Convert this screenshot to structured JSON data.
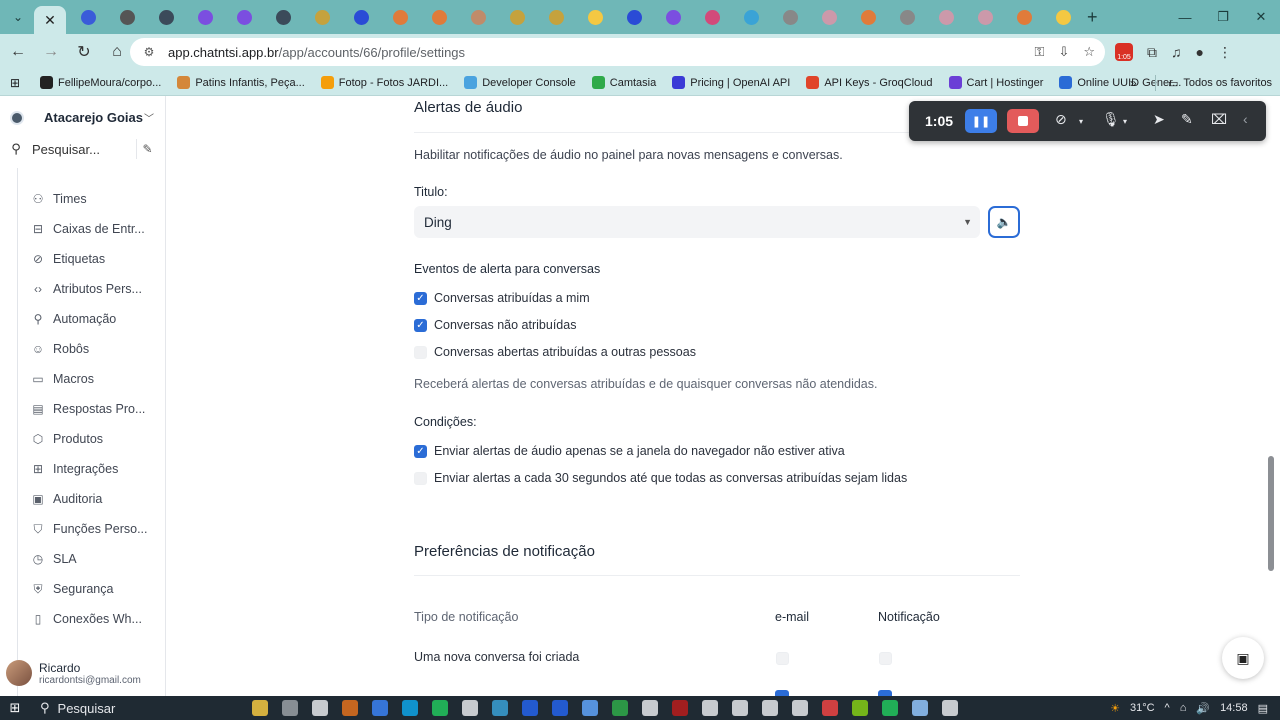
{
  "browser": {
    "tab_icons": [
      "#3a5bd9",
      "#555",
      "#3b4a5a",
      "#7b4ee0",
      "#7b4ee0",
      "#3b4a5a",
      "#c5a23d",
      "#2a4bd6",
      "#e07b3a",
      "#e07b3a",
      "#c08b6a",
      "#c5a23d",
      "#c5a23d",
      "#f4c842",
      "#2a4bd6",
      "#7b4ee0",
      "#d24a7a",
      "#3aa3d6",
      "#888",
      "#c9a",
      "#e07b3a",
      "#888",
      "#c9a",
      "#c9a",
      "#e07b3a",
      "#f4c842"
    ],
    "url_host": "app.chatntsi.app.br",
    "url_path": "/app/accounts/66/profile/settings",
    "bookmarks": [
      {
        "label": "FellipeMoura/corpo...",
        "color": "#222"
      },
      {
        "label": "Patins Infantis, Peça...",
        "color": "#d4873a"
      },
      {
        "label": "Fotop - Fotos JARDI...",
        "color": "#f59e0b"
      },
      {
        "label": "Developer Console",
        "color": "#4aa3df"
      },
      {
        "label": "Camtasia",
        "color": "#2faa4a"
      },
      {
        "label": "Pricing | OpenAI API",
        "color": "#3a3ad6"
      },
      {
        "label": "API Keys - GroqCloud",
        "color": "#e0452a"
      },
      {
        "label": "Cart | Hostinger",
        "color": "#6b3fd6"
      },
      {
        "label": "Online UUID Gener...",
        "color": "#2a6bd6"
      }
    ],
    "all_bookmarks": "Todos os favoritos",
    "rec_badge": "1:05"
  },
  "sidebar": {
    "account_name": "Atacarejo Goias",
    "search_placeholder": "Pesquisar...",
    "items": [
      {
        "label": "Times",
        "icon": "users-icon",
        "glyph": "⚇"
      },
      {
        "label": "Caixas de Entr...",
        "icon": "inbox-icon",
        "glyph": "⊟"
      },
      {
        "label": "Etiquetas",
        "icon": "tag-icon",
        "glyph": "⊘"
      },
      {
        "label": "Atributos Pers...",
        "icon": "code-icon",
        "glyph": "‹›"
      },
      {
        "label": "Automação",
        "icon": "automation-icon",
        "glyph": "⚲"
      },
      {
        "label": "Robôs",
        "icon": "bot-icon",
        "glyph": "☺"
      },
      {
        "label": "Macros",
        "icon": "macro-icon",
        "glyph": "▭"
      },
      {
        "label": "Respostas Pro...",
        "icon": "reply-icon",
        "glyph": "▤"
      },
      {
        "label": "Produtos",
        "icon": "box-icon",
        "glyph": "⬡"
      },
      {
        "label": "Integrações",
        "icon": "integration-icon",
        "glyph": "⊞"
      },
      {
        "label": "Auditoria",
        "icon": "briefcase-icon",
        "glyph": "▣"
      },
      {
        "label": "Funções Perso...",
        "icon": "shield-user-icon",
        "glyph": "⛉"
      },
      {
        "label": "SLA",
        "icon": "clock-icon",
        "glyph": "◷"
      },
      {
        "label": "Segurança",
        "icon": "shield-icon",
        "glyph": "⛨"
      },
      {
        "label": "Conexões Wh...",
        "icon": "phone-icon",
        "glyph": "▯"
      }
    ],
    "user_name": "Ricardo",
    "user_email": "ricardontsi@gmail.com"
  },
  "audio": {
    "title": "Alertas de áudio",
    "description": "Habilitar notificações de áudio no painel para novas mensagens e conversas.",
    "tone_label": "Titulo:",
    "tone_value": "Ding",
    "events_label": "Eventos de alerta para conversas",
    "events": [
      {
        "label": "Conversas atribuídas a mim",
        "checked": true
      },
      {
        "label": "Conversas não atribuídas",
        "checked": true
      },
      {
        "label": "Conversas abertas atribuídas a outras pessoas",
        "checked": false
      }
    ],
    "events_hint": "Receberá alertas de conversas atribuídas e de quaisquer conversas não atendidas.",
    "conditions_label": "Condições:",
    "conditions": [
      {
        "label": "Enviar alertas de áudio apenas se a janela do navegador não estiver ativa",
        "checked": true
      },
      {
        "label": "Enviar alertas a cada 30 segundos até que todas as conversas atribuídas sejam lidas",
        "checked": false
      }
    ]
  },
  "notifications": {
    "title": "Preferências de notificação",
    "col_type": "Tipo de notificação",
    "col_email": "e-mail",
    "col_push": "Notificação",
    "row1": "Uma nova conversa foi criada"
  },
  "recorder": {
    "time": "1:05"
  },
  "taskbar": {
    "search": "Pesquisar",
    "temp": "31°C",
    "clock": "14:58"
  }
}
